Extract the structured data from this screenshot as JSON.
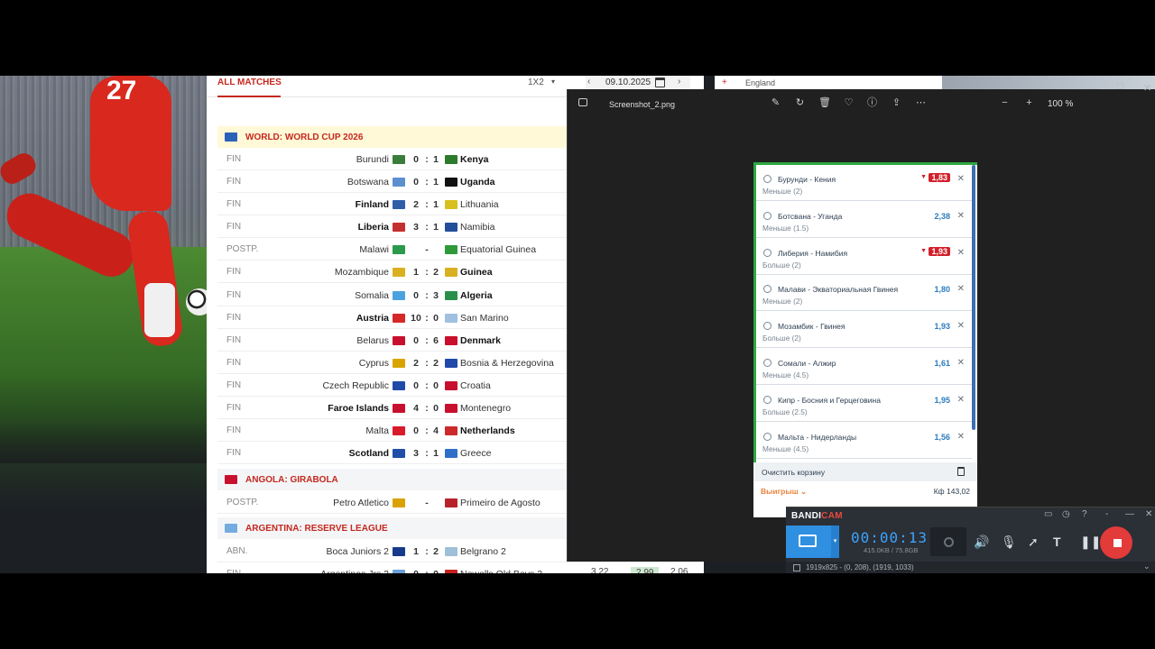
{
  "tabs": {
    "all_matches": "ALL MATCHES",
    "odds_type": "1X2",
    "date": "09.10.2025"
  },
  "topstrip": {
    "text": "England"
  },
  "leagues": [
    {
      "name": "WORLD: WORLD CUP 2026"
    },
    {
      "name": "ANGOLA: GIRABOLA"
    },
    {
      "name": "ARGENTINA: RESERVE LEAGUE"
    }
  ],
  "matches": [
    {
      "status": "FIN",
      "home": "Burundi",
      "hs": "0",
      "as": "1",
      "away": "Kenya",
      "winner": "away"
    },
    {
      "status": "FIN",
      "home": "Botswana",
      "hs": "0",
      "as": "1",
      "away": "Uganda",
      "winner": "away"
    },
    {
      "status": "FIN",
      "home": "Finland",
      "hs": "2",
      "as": "1",
      "away": "Lithuania",
      "winner": "home"
    },
    {
      "status": "FIN",
      "home": "Liberia",
      "hs": "3",
      "as": "1",
      "away": "Namibia",
      "winner": "home"
    },
    {
      "status": "POSTP.",
      "home": "Malawi",
      "hs": "",
      "as": "",
      "away": "Equatorial Guinea",
      "winner": ""
    },
    {
      "status": "FIN",
      "home": "Mozambique",
      "hs": "1",
      "as": "2",
      "away": "Guinea",
      "winner": "away"
    },
    {
      "status": "FIN",
      "home": "Somalia",
      "hs": "0",
      "as": "3",
      "away": "Algeria",
      "winner": "away"
    },
    {
      "status": "FIN",
      "home": "Austria",
      "hs": "10",
      "as": "0",
      "away": "San Marino",
      "winner": "home"
    },
    {
      "status": "FIN",
      "home": "Belarus",
      "hs": "0",
      "as": "6",
      "away": "Denmark",
      "winner": "away"
    },
    {
      "status": "FIN",
      "home": "Cyprus",
      "hs": "2",
      "as": "2",
      "away": "Bosnia & Herzegovina",
      "winner": ""
    },
    {
      "status": "FIN",
      "home": "Czech Republic",
      "hs": "0",
      "as": "0",
      "away": "Croatia",
      "winner": ""
    },
    {
      "status": "FIN",
      "home": "Faroe Islands",
      "hs": "4",
      "as": "0",
      "away": "Montenegro",
      "winner": "home"
    },
    {
      "status": "FIN",
      "home": "Malta",
      "hs": "0",
      "as": "4",
      "away": "Netherlands",
      "winner": "away"
    },
    {
      "status": "FIN",
      "home": "Scotland",
      "hs": "3",
      "as": "1",
      "away": "Greece",
      "winner": "home"
    },
    {
      "status": "POSTP.",
      "home": "Petro Atletico",
      "hs": "",
      "as": "",
      "away": "Primeiro de Agosto",
      "winner": ""
    },
    {
      "status": "ABN.",
      "home": "Boca Juniors 2",
      "hs": "1",
      "as": "2",
      "away": "Belgrano 2",
      "winner": ""
    },
    {
      "status": "FIN",
      "home": "Argentinos Jrs 2",
      "hs": "0",
      "as": "0",
      "away": "Newells Old Boys 2",
      "winner": "",
      "o1": "3.22",
      "ox": "2.99",
      "o2": "2.06"
    }
  ],
  "dash": "-",
  "colon": ":",
  "viewer": {
    "title": "Screenshot_2.png",
    "zoom": "100 %"
  },
  "coupon": {
    "bets": [
      {
        "teams": "Бурунди - Кения",
        "market": "Меньше (2)",
        "odd": "1,83",
        "drop": true
      },
      {
        "teams": "Ботсвана - Уганда",
        "market": "Меньше (1.5)",
        "odd": "2,38",
        "drop": false
      },
      {
        "teams": "Либерия - Намибия",
        "market": "Больше (2)",
        "odd": "1,93",
        "drop": true
      },
      {
        "teams": "Малави - Экваториальная Гвинея",
        "market": "Меньше (2)",
        "odd": "1,80",
        "drop": false
      },
      {
        "teams": "Мозамбик - Гвинея",
        "market": "Больше (2)",
        "odd": "1,93",
        "drop": false
      },
      {
        "teams": "Сомали - Алжир",
        "market": "Меньше (4.5)",
        "odd": "1,61",
        "drop": false
      },
      {
        "teams": "Кипр - Босния и Герцеговина",
        "market": "Больше (2.5)",
        "odd": "1,95",
        "drop": false
      },
      {
        "teams": "Мальта - Нидерланды",
        "market": "Меньше (4.5)",
        "odd": "1,56",
        "drop": false
      }
    ],
    "clear": "Очистить корзину",
    "winnings": "Выигрыш ⌄",
    "kf": "Кф 143,02"
  },
  "bandicam": {
    "logo_a": "BANDI",
    "logo_b": "CAM",
    "timer": "00:00:13",
    "size": "415.0KB / 75.8GB",
    "resolution": "1919x825 - (0, 208), (1919, 1033)"
  },
  "colors": {
    "accent": "#c4281e",
    "highlight": "#fff9d8",
    "coupon_green": "#2ea843",
    "bandicam_blue": "#2f8fe0"
  }
}
